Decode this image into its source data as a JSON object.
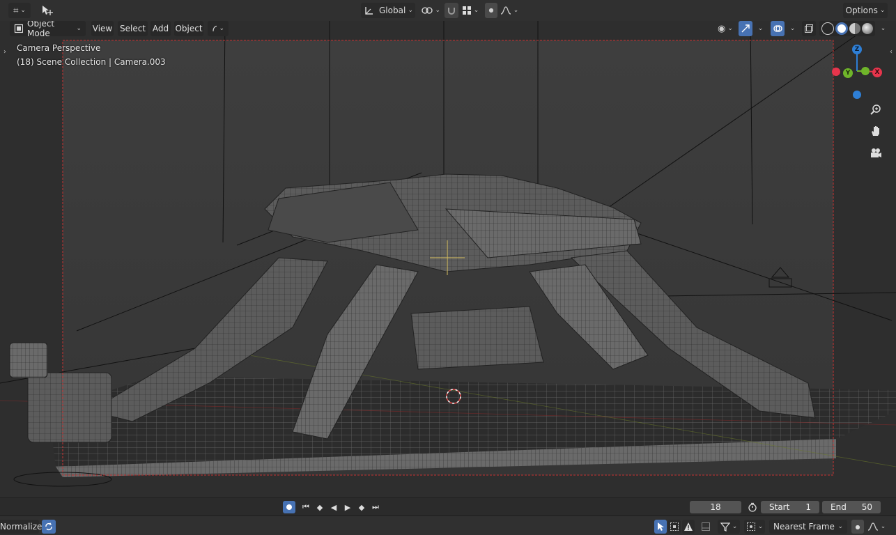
{
  "header": {
    "transform_orientation": "Global",
    "options_label": "Options"
  },
  "viewport_header": {
    "mode_label": "Object Mode",
    "menus": [
      "View",
      "Select",
      "Add",
      "Object"
    ]
  },
  "viewport": {
    "camera_label": "Camera Perspective",
    "collection_label": "(18) Scene Collection | Camera.003"
  },
  "gizmo": {
    "axes": {
      "x": "X",
      "y": "Y",
      "z": "Z"
    },
    "colors": {
      "x": "#e8354c",
      "y": "#6fb52a",
      "z": "#2e7fd6"
    }
  },
  "timeline": {
    "current_frame": "18",
    "start_label": "Start",
    "start_value": "1",
    "end_label": "End",
    "end_value": "50"
  },
  "bottom": {
    "normalize_label": "Normalize",
    "snap_mode": "Nearest Frame"
  },
  "colors": {
    "accent": "#4772b3",
    "camera_frame": "#c83232",
    "cursor": "#d44"
  }
}
